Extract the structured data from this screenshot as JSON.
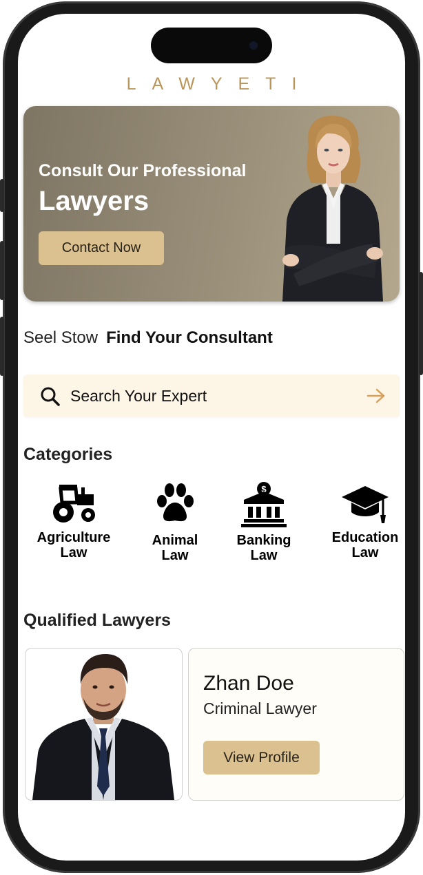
{
  "app": {
    "brand": "LAWYETI"
  },
  "colors": {
    "accent": "#dcc190",
    "brand": "#b9955a",
    "search_bg": "#fdf5e6",
    "arrow": "#d8a05a"
  },
  "hero": {
    "subtitle": "Consult Our Professional",
    "title": "Lawyers",
    "button_label": "Contact Now"
  },
  "finder": {
    "lead": "Seel Stow",
    "headline": "Find Your Consultant"
  },
  "search": {
    "placeholder": "Search Your Expert",
    "icon": "search-icon",
    "action_icon": "arrow-right-icon"
  },
  "categories": {
    "title": "Categories",
    "items": [
      {
        "line1": "Agriculture",
        "line2": "Law",
        "icon": "tractor-icon"
      },
      {
        "line1": "Animal",
        "line2": "Law",
        "icon": "paw-icon"
      },
      {
        "line1": "Banking",
        "line2": "Law",
        "icon": "bank-icon"
      },
      {
        "line1": "Education",
        "line2": "Law",
        "icon": "graduation-cap-icon"
      }
    ]
  },
  "lawyers": {
    "title": "Qualified Lawyers",
    "items": [
      {
        "name": "Zhan Doe",
        "role": "Criminal Lawyer",
        "button_label": "View Profile"
      }
    ]
  }
}
